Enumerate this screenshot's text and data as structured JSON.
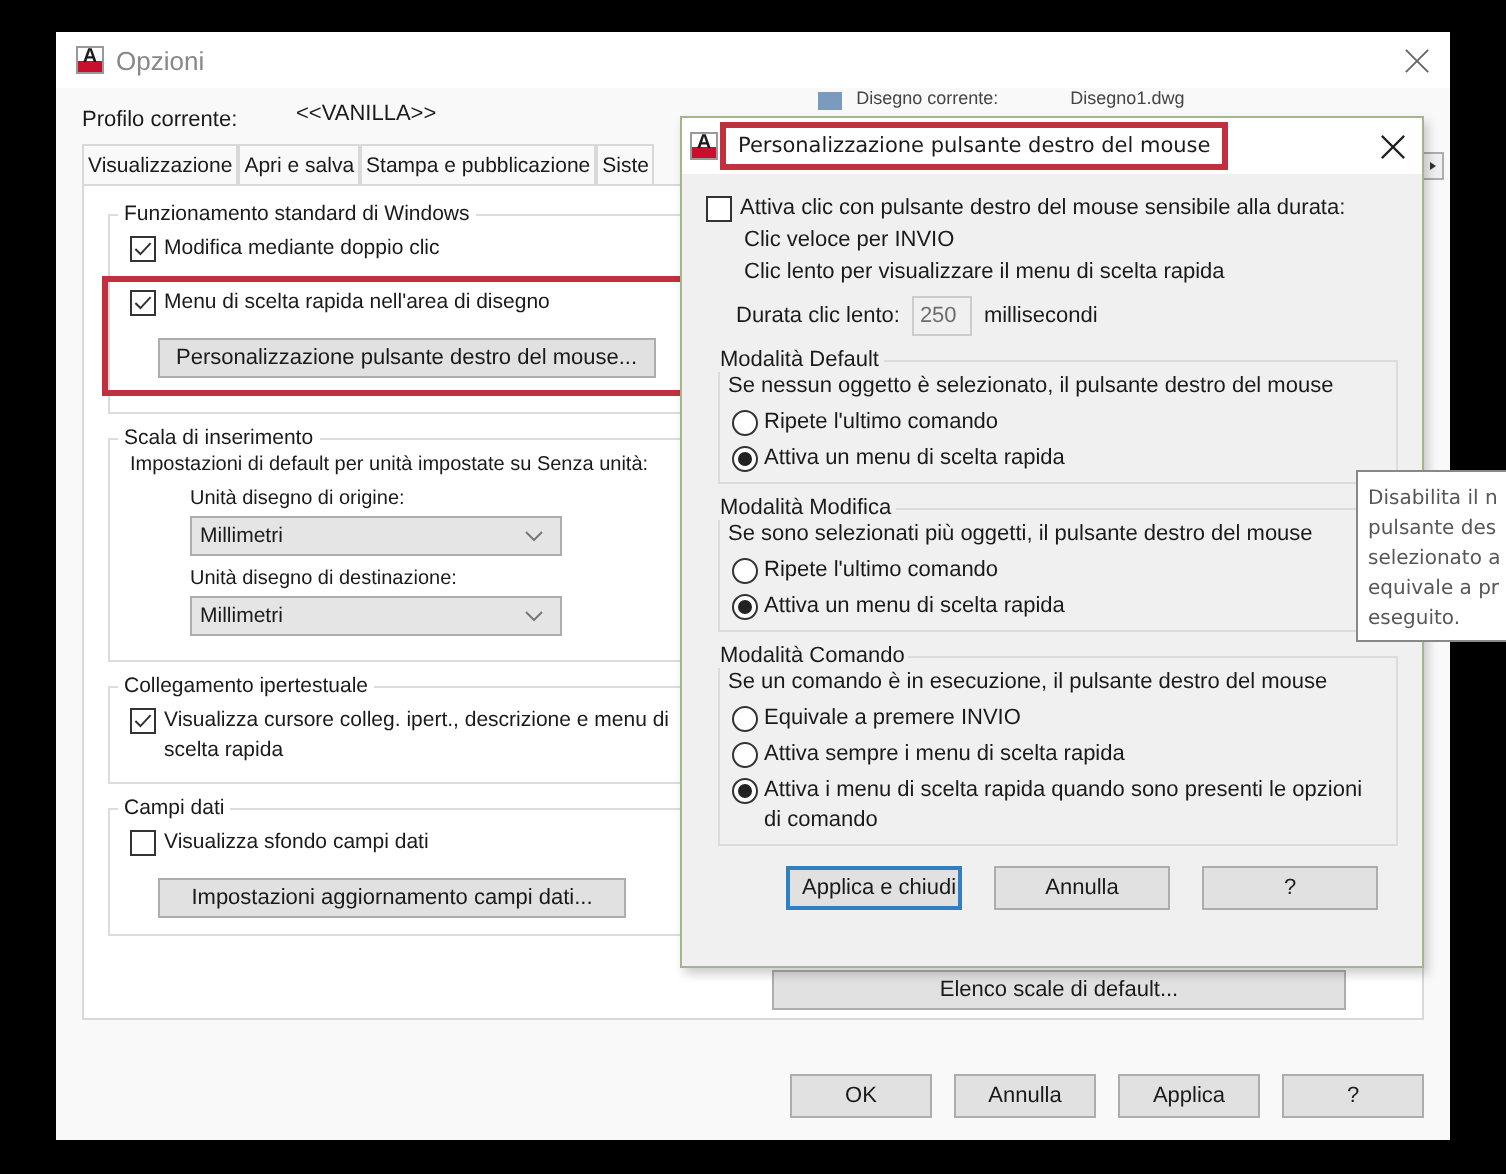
{
  "window": {
    "logo_letter": "A",
    "title": "Opzioni"
  },
  "profile": {
    "label": "Profilo corrente:",
    "value": "<<VANILLA>>"
  },
  "drawing": {
    "label": "Disegno corrente:",
    "value": "Disegno1.dwg"
  },
  "tabs": [
    {
      "label": "Visualizzazione",
      "selected": false
    },
    {
      "label": "Apri e salva",
      "selected": false
    },
    {
      "label": "Stampa e pubblicazione",
      "selected": false
    },
    {
      "label": "Siste",
      "selected": false
    }
  ],
  "groups": [
    {
      "title": "Funzionamento standard di Windows",
      "items": [
        {
          "kind": "checkbox",
          "label": "Modifica mediante doppio clic",
          "checked": true
        },
        {
          "kind": "highlight",
          "items": [
            {
              "kind": "checkbox",
              "label": "Menu di scelta rapida nell'area di disegno",
              "checked": true
            },
            {
              "kind": "button",
              "label": "Personalizzazione pulsante destro del mouse..."
            }
          ]
        }
      ]
    },
    {
      "title": "Scala di inserimento",
      "items": [
        {
          "kind": "text",
          "label": "Impostazioni di default per unità impostate su Senza unità:"
        },
        {
          "kind": "select",
          "label": "Unità disegno di origine:",
          "value": "Millimetri"
        },
        {
          "kind": "select",
          "label": "Unità disegno di destinazione:",
          "value": "Millimetri"
        }
      ]
    },
    {
      "title": "Collegamento ipertestuale",
      "items": [
        {
          "kind": "checkbox",
          "label": "Visualizza cursore colleg. ipert., descrizione e menu di scelta rapida",
          "checked": true
        }
      ]
    },
    {
      "title": "Campi dati",
      "items": [
        {
          "kind": "checkbox",
          "label": "Visualizza sfondo campi dati",
          "checked": false
        },
        {
          "kind": "button",
          "label": "Impostazioni aggiornamento campi dati..."
        }
      ]
    }
  ],
  "right_button": "Elenco scale di default...",
  "buttons": [
    "OK",
    "Annulla",
    "Applica",
    "?"
  ],
  "dialog": {
    "logo_letter": "A",
    "title": "Personalizzazione pulsante destro del mouse",
    "highlighted": true,
    "timed_checkbox": {
      "label": "Attiva clic con pulsante destro del mouse sensibile alla durata:",
      "checked": false
    },
    "notes": [
      "Clic veloce per INVIO",
      "Clic lento per visualizzare il menu di scelta rapida"
    ],
    "duration": {
      "label": "Durata clic lento:",
      "value": "250",
      "unit": "millisecondi",
      "disabled": true
    },
    "groups": [
      {
        "title": "Modalità Default",
        "description": "Se nessun oggetto è selezionato, il pulsante destro del mouse",
        "options": [
          {
            "label": "Ripete l'ultimo comando",
            "selected": false
          },
          {
            "label": "Attiva un menu di scelta rapida",
            "selected": true
          }
        ]
      },
      {
        "title": "Modalità Modifica",
        "description": "Se sono selezionati più oggetti, il pulsante destro del mouse",
        "options": [
          {
            "label": "Ripete l'ultimo comando",
            "selected": false
          },
          {
            "label": "Attiva un menu di scelta rapida",
            "selected": true
          }
        ]
      },
      {
        "title": "Modalità Comando",
        "description": "Se un comando è in esecuzione, il pulsante destro del mouse",
        "options": [
          {
            "label": "Equivale a premere INVIO",
            "selected": false
          },
          {
            "label": "Attiva sempre i menu di scelta rapida",
            "selected": false
          },
          {
            "label": "Attiva i menu di scelta rapida quando sono presenti le opzioni di comando",
            "selected": true
          }
        ]
      }
    ],
    "buttons": [
      {
        "label": "Applica e chiudi",
        "focused": true
      },
      {
        "label": "Annulla",
        "focused": false
      },
      {
        "label": "?",
        "focused": false
      }
    ]
  },
  "tooltip": {
    "lines": [
      "Disabilita il n",
      "pulsante des",
      "selezionato a",
      "equivale a pr",
      "eseguito."
    ]
  }
}
